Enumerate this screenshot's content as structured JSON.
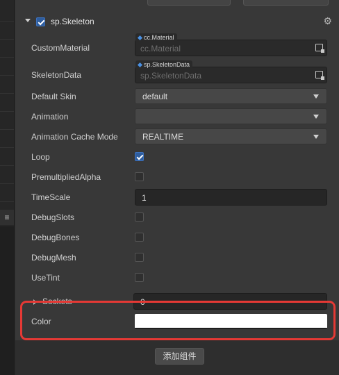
{
  "component": {
    "title": "sp.Skeleton",
    "enabled": true
  },
  "properties": {
    "custom_material": {
      "label": "CustomMaterial",
      "asset_type": "cc.Material",
      "placeholder": "cc.Material"
    },
    "skeleton_data": {
      "label": "SkeletonData",
      "asset_type": "sp.SkeletonData",
      "placeholder": "sp.SkeletonData"
    },
    "default_skin": {
      "label": "Default Skin",
      "value": "default"
    },
    "animation": {
      "label": "Animation",
      "value": ""
    },
    "animation_cache_mode": {
      "label": "Animation Cache Mode",
      "value": "REALTIME"
    },
    "loop": {
      "label": "Loop",
      "checked": true
    },
    "premultiplied_alpha": {
      "label": "PremultipliedAlpha",
      "checked": false
    },
    "time_scale": {
      "label": "TimeScale",
      "value": "1"
    },
    "debug_slots": {
      "label": "DebugSlots",
      "checked": false
    },
    "debug_bones": {
      "label": "DebugBones",
      "checked": false
    },
    "debug_mesh": {
      "label": "DebugMesh",
      "checked": false
    },
    "use_tint": {
      "label": "UseTint",
      "checked": false
    },
    "sockets": {
      "label": "Sockets",
      "value": "0"
    },
    "color": {
      "label": "Color",
      "value": "#ffffff"
    }
  },
  "add_component_label": "添加组件",
  "icons": {
    "collapse": "chevron-down-icon",
    "settings": "gear-icon",
    "asset_picker": "asset-picker-icon",
    "list": "hamburger-icon"
  },
  "colors": {
    "highlight": "#e53935",
    "checkbox_checked": "#2e5d9e",
    "asset_dot": "#4a90e2"
  }
}
